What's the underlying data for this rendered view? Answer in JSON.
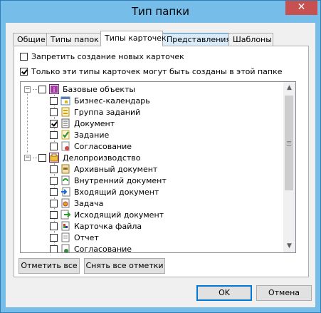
{
  "window": {
    "title": "Тип папки",
    "close_glyph": "✕"
  },
  "tabs": [
    {
      "label": "Общие"
    },
    {
      "label": "Типы папок"
    },
    {
      "label": "Типы карточек"
    },
    {
      "label": "Представления"
    },
    {
      "label": "Шаблоны"
    }
  ],
  "options": {
    "forbid_new_cards": {
      "label": "Запретить создание новых карточек",
      "checked": false
    },
    "only_these_types": {
      "label": "Только эти типы карточек могут быть созданы в этой папке",
      "checked": true
    }
  },
  "tree": {
    "groups": [
      {
        "label": "Базовые объекты",
        "expander": "−",
        "checked": false,
        "icon": "base-objects-icon",
        "items": [
          {
            "label": "Бизнес-календарь",
            "checked": false,
            "icon": "calendar-icon"
          },
          {
            "label": "Группа заданий",
            "checked": false,
            "icon": "task-group-icon"
          },
          {
            "label": "Документ",
            "checked": true,
            "icon": "document-icon"
          },
          {
            "label": "Задание",
            "checked": false,
            "icon": "task-icon"
          },
          {
            "label": "Согласование",
            "checked": false,
            "icon": "approval-icon"
          }
        ]
      },
      {
        "label": "Делопроизводство",
        "expander": "−",
        "checked": false,
        "icon": "records-management-icon",
        "items": [
          {
            "label": "Архивный документ",
            "checked": false,
            "icon": "archive-document-icon"
          },
          {
            "label": "Внутренний документ",
            "checked": false,
            "icon": "internal-document-icon"
          },
          {
            "label": "Входящий документ",
            "checked": false,
            "icon": "incoming-document-icon"
          },
          {
            "label": "Задача",
            "checked": false,
            "icon": "assignment-icon"
          },
          {
            "label": "Исходящий документ",
            "checked": false,
            "icon": "outgoing-document-icon"
          },
          {
            "label": "Карточка файла",
            "checked": false,
            "icon": "file-card-icon"
          },
          {
            "label": "Отчет",
            "checked": false,
            "icon": "report-icon"
          },
          {
            "label": "Согласование",
            "checked": false,
            "icon": "approval-icon"
          }
        ]
      }
    ]
  },
  "buttons": {
    "check_all": "Отметить все",
    "uncheck_all": "Снять все отметки",
    "ok": "OK",
    "cancel": "Отмена"
  },
  "colors": {
    "title_bar": "#76bdea",
    "close_button": "#c75050",
    "default_button_border": "#0078d7"
  }
}
